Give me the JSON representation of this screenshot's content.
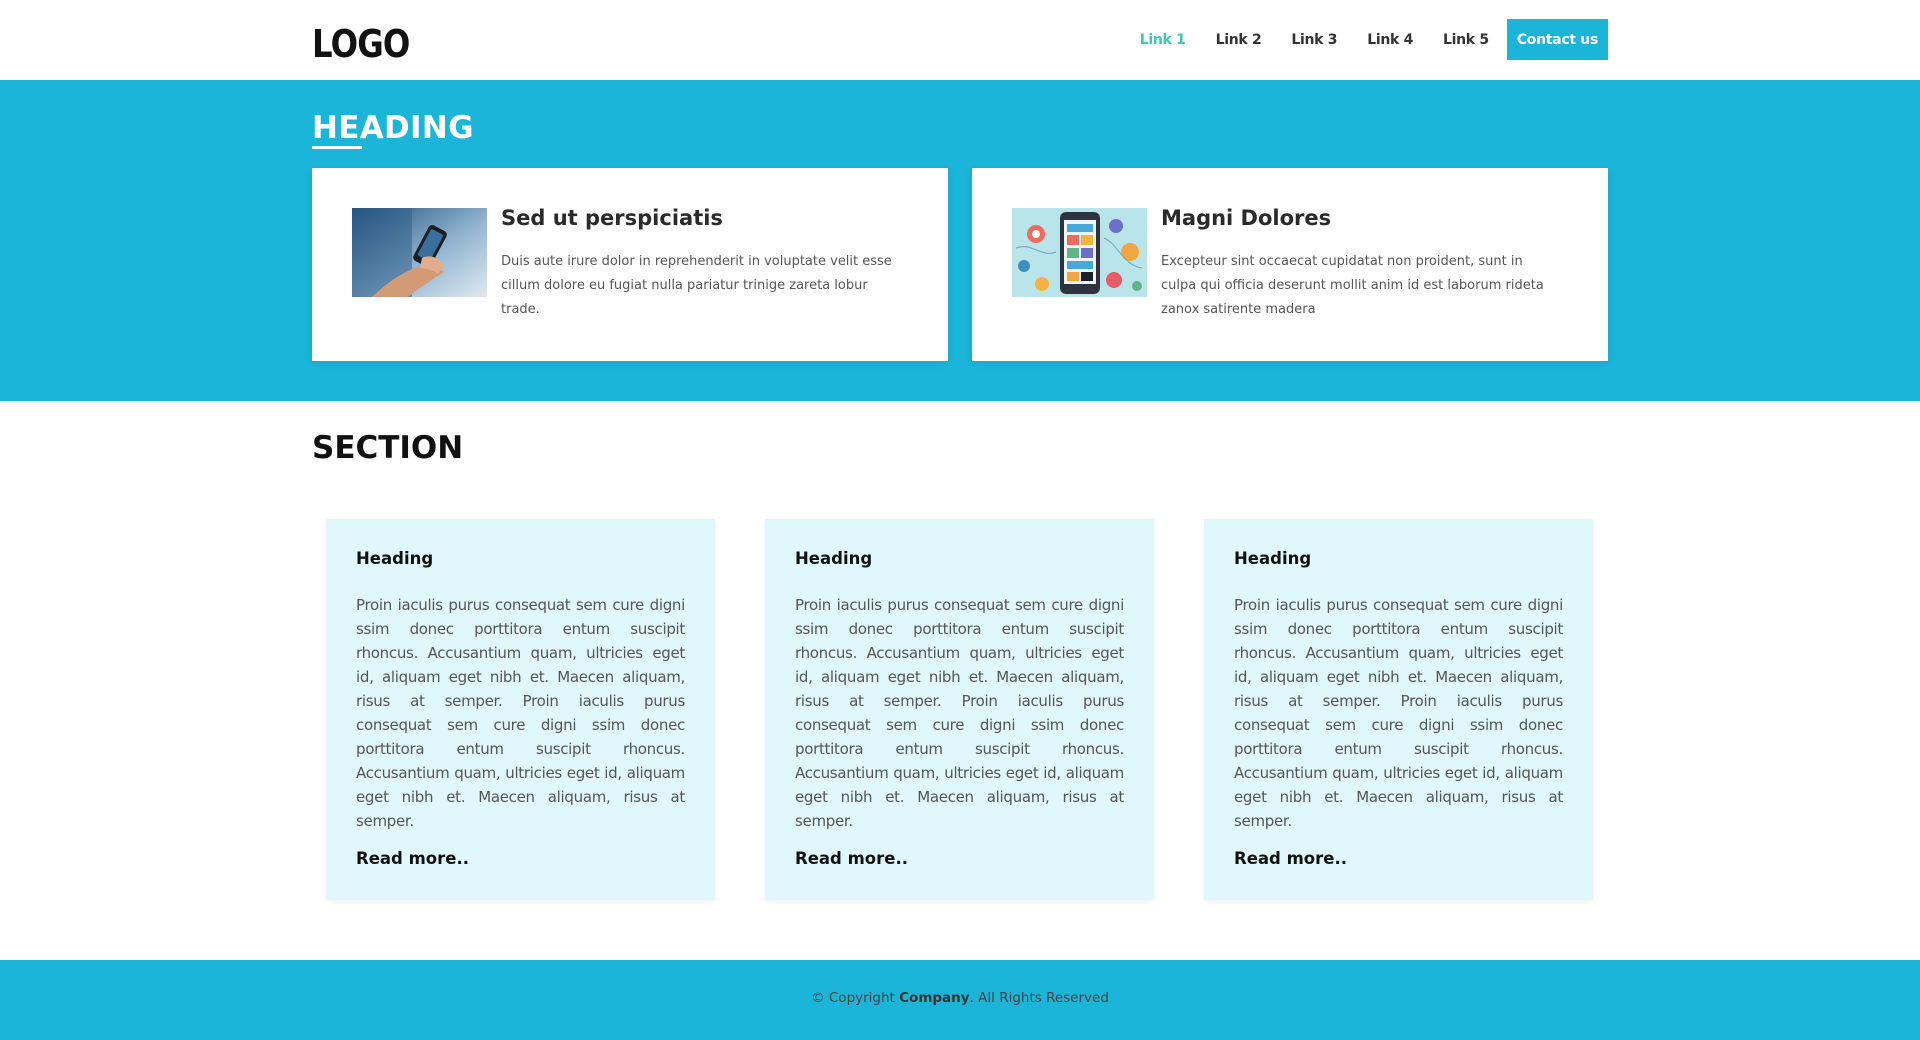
{
  "header": {
    "logo": "LOGO",
    "nav": [
      "Link 1",
      "Link 2",
      "Link 3",
      "Link 4",
      "Link 5"
    ],
    "cta": "Contact us",
    "active_link_color": "#3ec9a8",
    "cta_color": "#1db5d7"
  },
  "hero": {
    "heading": "HEADING",
    "background": "#1ab5d8",
    "cards": [
      {
        "title": "Sed ut perspiciatis",
        "text": "Duis aute irure dolor in reprehenderit in voluptate velit esse cillum dolore eu fugiat nulla pariatur trinige zareta lobur trade.",
        "image": "hand-holding-phone-photo"
      },
      {
        "title": "Magni Dolores",
        "text": "Excepteur sint occaecat cupidatat non proident, sunt in culpa qui officia deserunt mollit anim id est laborum rideta zanox satirente madera",
        "image": "phone-apps-illustration"
      }
    ]
  },
  "section": {
    "title": "SECTION",
    "card_background": "#e0f8fc",
    "features": [
      {
        "title": "Heading",
        "text": "Proin iaculis purus consequat sem cure digni ssim donec porttitora entum suscipit rhoncus. Accusantium quam, ultricies eget id, aliquam eget nibh et. Maecen aliquam, risus at semper. Proin iaculis purus consequat sem cure digni ssim donec porttitora entum suscipit rhoncus. Accusantium quam, ultricies eget id, aliquam eget nibh et. Maecen aliquam, risus at semper.",
        "link": "Read more.."
      },
      {
        "title": "Heading",
        "text": "Proin iaculis purus consequat sem cure digni ssim donec porttitora entum suscipit rhoncus. Accusantium quam, ultricies eget id, aliquam eget nibh et. Maecen aliquam, risus at semper. Proin iaculis purus consequat sem cure digni ssim donec porttitora entum suscipit rhoncus. Accusantium quam, ultricies eget id, aliquam eget nibh et. Maecen aliquam, risus at semper.",
        "link": "Read more.."
      },
      {
        "title": "Heading",
        "text": "Proin iaculis purus consequat sem cure digni ssim donec porttitora entum suscipit rhoncus. Accusantium quam, ultricies eget id, aliquam eget nibh et. Maecen aliquam, risus at semper. Proin iaculis purus consequat sem cure digni ssim donec porttitora entum suscipit rhoncus. Accusantium quam, ultricies eget id, aliquam eget nibh et. Maecen aliquam, risus at semper.",
        "link": "Read more.."
      }
    ]
  },
  "footer": {
    "prefix": "© Copyright ",
    "company": "Company",
    "suffix": ". All Rights Reserved",
    "background": "#1ab5d8"
  }
}
